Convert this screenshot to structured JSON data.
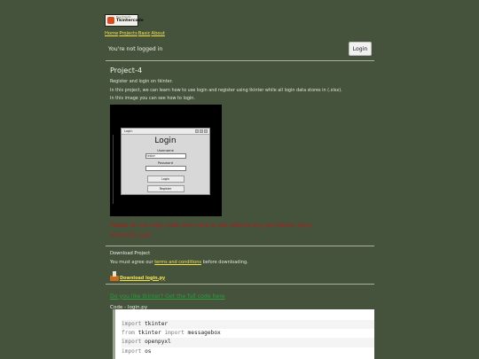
{
  "site": {
    "logo_small": "Free Projects",
    "logo_big": "Tkintercode",
    "brand_color": "#f3e24a"
  },
  "nav": [
    {
      "label": "Home"
    },
    {
      "label": "Projects"
    },
    {
      "label": "Basic"
    },
    {
      "label": "About"
    }
  ],
  "auth": {
    "status": "You're not logged in",
    "login_label": "Login"
  },
  "project": {
    "title": "Project-4",
    "subtitle": "Register and login on tkinter.",
    "description": "In this project, we can learn how to use login and register using tkinter while all login data stores in (.xlsx).",
    "image_caption": "In this image you can see how to login.",
    "warning": "Please do not copy code from here or sell without any permission (only instructor can)."
  },
  "preview": {
    "window_title": "Login",
    "heading": "Login",
    "username_label": "Username",
    "username_value": "tester",
    "password_label": "Password",
    "password_value": "",
    "login_button": "Login",
    "register_button": "Register"
  },
  "download": {
    "section_title": "Download Project",
    "agree_prefix": "You must agree our ",
    "terms_link": "terms and conditions",
    "agree_suffix": " before downloading.",
    "file_link": "Download login.py"
  },
  "code": {
    "green_link": "Do you like tkinter? Get the full code here",
    "label": "Code - login.py",
    "lines": [
      {
        "kw": "import",
        "rest": " tkinter",
        "kw2": "",
        "rest2": ""
      },
      {
        "kw": "from",
        "rest": " tkinter ",
        "kw2": "import",
        "rest2": " messagebox"
      },
      {
        "kw": "import",
        "rest": " openpyxl",
        "kw2": "",
        "rest2": ""
      },
      {
        "kw": "import",
        "rest": " os",
        "kw2": "",
        "rest2": ""
      }
    ]
  }
}
